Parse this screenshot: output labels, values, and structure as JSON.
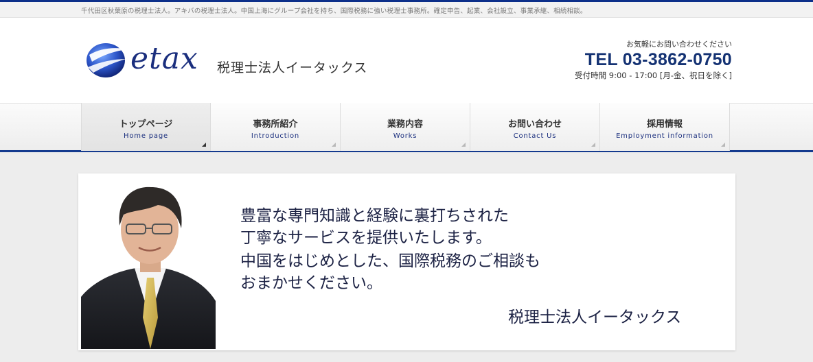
{
  "tagline": "千代田区秋葉原の税理士法人。アキバの税理士法人。中国上海にグループ会社を持ち、国際税務に強い税理士事務所。確定申告、起業、会社設立、事業承継、相続相談。",
  "header": {
    "logo_word": "etax",
    "logo_company": "税理士法人イータックス",
    "contact_note": "お気軽にお問い合わせください",
    "tel": "TEL 03-3862-0750",
    "hours": "受付時間 9:00 - 17:00 [月-金、祝日を除く]"
  },
  "nav": {
    "items": [
      {
        "jp": "トップページ",
        "en": "Home page"
      },
      {
        "jp": "事務所紹介",
        "en": "Introduction"
      },
      {
        "jp": "業務内容",
        "en": "Works"
      },
      {
        "jp": "お問い合わせ",
        "en": "Contact Us"
      },
      {
        "jp": "採用情報",
        "en": "Employment information"
      }
    ]
  },
  "banner": {
    "lines": [
      "豊富な専門知識と経験に裏打ちされた",
      "丁寧なサービスを提供いたします。",
      "中国をはじめとした、国際税務のご相談も",
      "おまかせください。"
    ],
    "signature": "税理士法人イータックス"
  },
  "colors": {
    "brand_navy": "#1b2f7e",
    "tel_navy": "#143273",
    "nav_bar_line": "#143a8e"
  }
}
